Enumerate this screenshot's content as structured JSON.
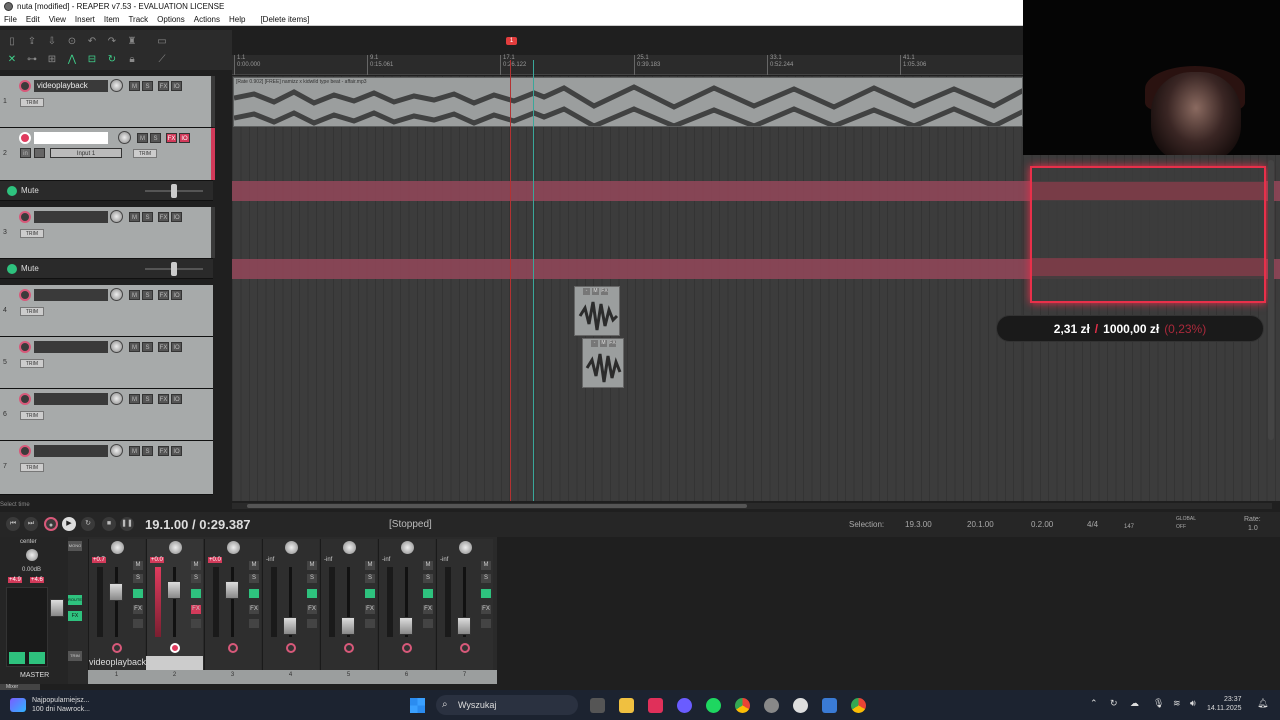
{
  "window": {
    "title": "nuta [modified] - REAPER v7.53 - EVALUATION LICENSE"
  },
  "menu": [
    "File",
    "Edit",
    "View",
    "Insert",
    "Item",
    "Track",
    "Options",
    "Actions",
    "Help",
    "[Delete items]"
  ],
  "ruler": {
    "marker": "1",
    "ticks": [
      {
        "bar": "1.1",
        "time": "0:00.000"
      },
      {
        "bar": "9.1",
        "time": "0:15.061"
      },
      {
        "bar": "17.1",
        "time": "0:26.122"
      },
      {
        "bar": "25.1",
        "time": "0:39.183"
      },
      {
        "bar": "33.1",
        "time": "0:52.244"
      },
      {
        "bar": "41.1",
        "time": "1:05.306"
      }
    ]
  },
  "item_main": {
    "label": "[Rate 0.902] [FREE] namizz x kidwild type beat - affair.mp3"
  },
  "tracks": [
    {
      "num": "1",
      "name": "videoplayback",
      "trim": "TRIM"
    },
    {
      "num": "2",
      "name": "",
      "input": "Input 1",
      "trim": "TRIM"
    },
    {
      "num": "3",
      "name": "",
      "trim": "TRIM"
    },
    {
      "num": "4",
      "name": "",
      "trim": "TRIM"
    },
    {
      "num": "5",
      "name": "",
      "trim": "TRIM"
    },
    {
      "num": "6",
      "name": "",
      "trim": "TRIM"
    },
    {
      "num": "7",
      "name": "",
      "trim": "TRIM"
    }
  ],
  "envelope_label": "Mute",
  "buttons": {
    "m": "M",
    "s": "S",
    "fx": "FX",
    "io": "IO",
    "in": "in"
  },
  "donation": {
    "current": "2,31 zł",
    "goal": "1000,00 zł",
    "percent": "(0,23%)"
  },
  "transport": {
    "time": "19.1.00 / 0:29.387",
    "state": "[Stopped]",
    "selection_label": "Selection:",
    "sel_start": "19.3.00",
    "sel_end": "20.1.00",
    "sel_len": "0.2.00",
    "time_sig": "4/4",
    "bpm": "147",
    "global": "GLOBAL",
    "global_state": "OFF",
    "rate_label": "Rate:",
    "rate": "1.0",
    "status_hint": "Select time"
  },
  "mixer": {
    "master_label": "MASTER",
    "mixer_tab": "Mixer",
    "pan_label": "center",
    "master_db": "0.00dB",
    "master_peaks": [
      "+4.9",
      "+4.6"
    ],
    "strip_name": "videoplayback",
    "strip_numbers": [
      "1",
      "2",
      "3",
      "4",
      "5",
      "6",
      "7"
    ],
    "strip_peaks": [
      "+0.7",
      "+0.0",
      "+0.0",
      "-inf",
      "-inf",
      "-inf",
      "-inf"
    ],
    "mono": "MONO",
    "route": "ROUTE",
    "trim": "TRIM"
  },
  "taskbar": {
    "news_title": "Najpopularniejsz...",
    "news_sub": "100 dni Nawrock...",
    "search": "Wyszukaj",
    "time": "23:37",
    "date": "14.11.2025"
  },
  "colors": {
    "accent_red": "#e8304a",
    "armed_pink": "#d8597a",
    "env_green": "#2ec27e",
    "cursor_teal": "#3aa79a"
  }
}
